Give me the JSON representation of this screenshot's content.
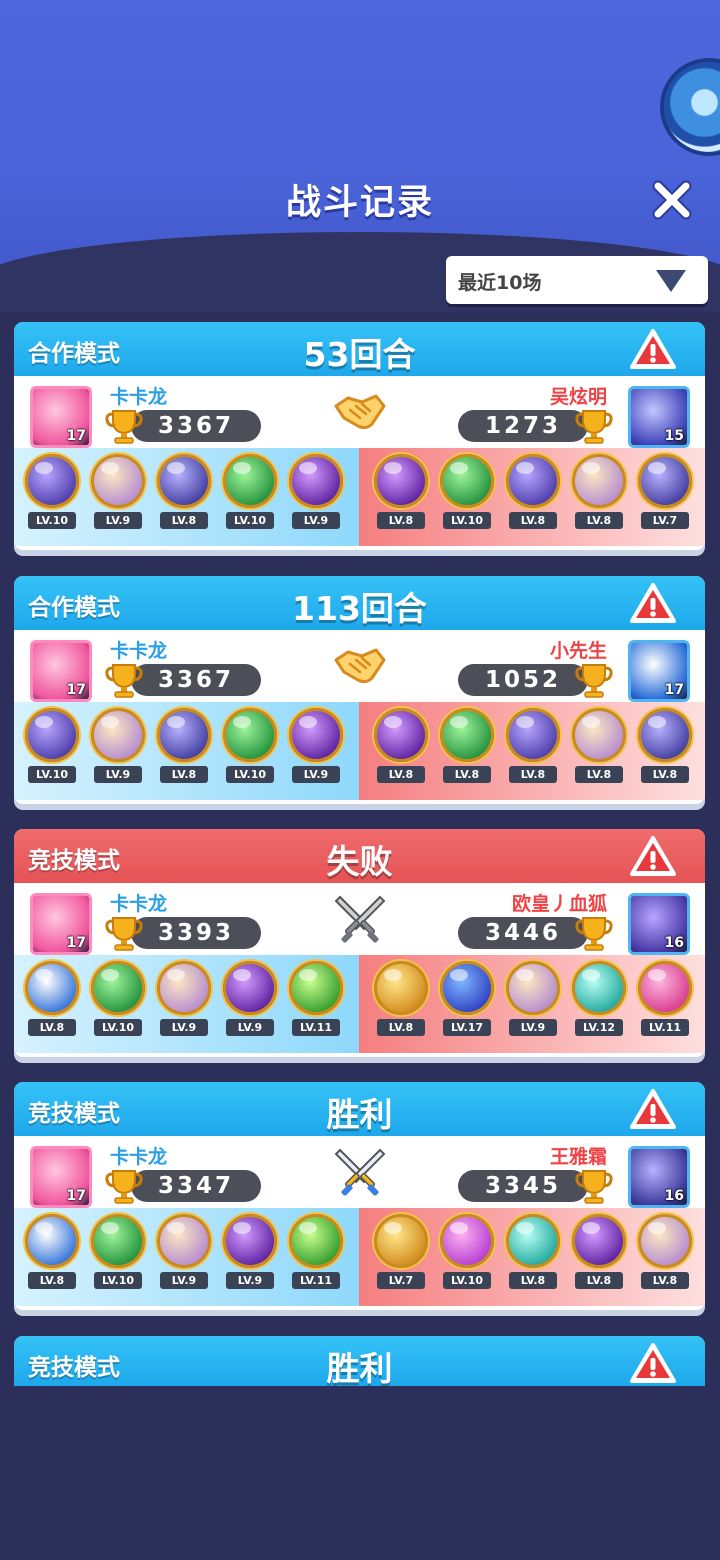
{
  "header": {
    "title": "战斗记录",
    "close_icon": "close-icon"
  },
  "filter": {
    "selected": "最近10场"
  },
  "orb_colors": {
    "ghost": [
      "#b7a6ff",
      "#4a3aa8"
    ],
    "squid": [
      "#fde7c2",
      "#b38ad0"
    ],
    "rock": [
      "#b9b2ff",
      "#3d3a9b"
    ],
    "arrow": [
      "#9ff59a",
      "#1f8e3a"
    ],
    "butterfly": [
      "#d49bff",
      "#5a1e9c"
    ],
    "koi": [
      "#ffffff",
      "#2d6fd8"
    ],
    "gem": [
      "#c9ff8e",
      "#2f9a2a"
    ],
    "knight": [
      "#ffe68a",
      "#d2891b"
    ],
    "swirl": [
      "#7fb6ff",
      "#2b3ec0"
    ],
    "tornado": [
      "#b7fff4",
      "#1ea69a"
    ],
    "feather": [
      "#ffb6df",
      "#d6388b"
    ],
    "jelly": [
      "#ffb1f2",
      "#b23ad0"
    ],
    "heart": [
      "#ffc7df",
      "#f0559d"
    ],
    "sphere": [
      "#c4c6ff",
      "#3f43b8"
    ]
  },
  "records": [
    {
      "mode": "合作模式",
      "result": "53回合",
      "style": "blue",
      "vs": "handshake",
      "me": {
        "name": "卡卡龙",
        "score": "3367",
        "avatar": "heart",
        "level": "17"
      },
      "op": {
        "name": "吴炫明",
        "score": "1273",
        "avatar": "sphere",
        "level": "15"
      },
      "me_units": [
        [
          "ghost",
          "LV.10"
        ],
        [
          "squid",
          "LV.9"
        ],
        [
          "rock",
          "LV.8"
        ],
        [
          "arrow",
          "LV.10"
        ],
        [
          "butterfly",
          "LV.9"
        ]
      ],
      "op_units": [
        [
          "butterfly",
          "LV.8"
        ],
        [
          "arrow",
          "LV.10"
        ],
        [
          "ghost",
          "LV.8"
        ],
        [
          "squid",
          "LV.8"
        ],
        [
          "rock",
          "LV.7"
        ]
      ]
    },
    {
      "mode": "合作模式",
      "result": "113回合",
      "style": "blue",
      "vs": "handshake",
      "me": {
        "name": "卡卡龙",
        "score": "3367",
        "avatar": "heart",
        "level": "17"
      },
      "op": {
        "name": "小先生",
        "score": "1052",
        "avatar": "koi",
        "level": "17"
      },
      "me_units": [
        [
          "ghost",
          "LV.10"
        ],
        [
          "squid",
          "LV.9"
        ],
        [
          "rock",
          "LV.8"
        ],
        [
          "arrow",
          "LV.10"
        ],
        [
          "butterfly",
          "LV.9"
        ]
      ],
      "op_units": [
        [
          "butterfly",
          "LV.8"
        ],
        [
          "arrow",
          "LV.8"
        ],
        [
          "ghost",
          "LV.8"
        ],
        [
          "squid",
          "LV.8"
        ],
        [
          "rock",
          "LV.8"
        ]
      ]
    },
    {
      "mode": "竞技模式",
      "result": "失败",
      "style": "red",
      "vs": "swords-grey",
      "me": {
        "name": "卡卡龙",
        "score": "3393",
        "avatar": "heart",
        "level": "17"
      },
      "op": {
        "name": "欧皇丿血狐",
        "score": "3446",
        "avatar": "ghost",
        "level": "16"
      },
      "me_units": [
        [
          "koi",
          "LV.8"
        ],
        [
          "arrow",
          "LV.10"
        ],
        [
          "squid",
          "LV.9"
        ],
        [
          "butterfly",
          "LV.9"
        ],
        [
          "gem",
          "LV.11"
        ]
      ],
      "op_units": [
        [
          "knight",
          "LV.8"
        ],
        [
          "swirl",
          "LV.17"
        ],
        [
          "squid",
          "LV.9"
        ],
        [
          "tornado",
          "LV.12"
        ],
        [
          "feather",
          "LV.11"
        ]
      ]
    },
    {
      "mode": "竞技模式",
      "result": "胜利",
      "style": "blue",
      "vs": "swords-color",
      "me": {
        "name": "卡卡龙",
        "score": "3347",
        "avatar": "heart",
        "level": "17"
      },
      "op": {
        "name": "王雅霜",
        "score": "3345",
        "avatar": "rock",
        "level": "16"
      },
      "me_units": [
        [
          "koi",
          "LV.8"
        ],
        [
          "arrow",
          "LV.10"
        ],
        [
          "squid",
          "LV.9"
        ],
        [
          "butterfly",
          "LV.9"
        ],
        [
          "gem",
          "LV.11"
        ]
      ],
      "op_units": [
        [
          "knight",
          "LV.7"
        ],
        [
          "jelly",
          "LV.10"
        ],
        [
          "tornado",
          "LV.8"
        ],
        [
          "butterfly",
          "LV.8"
        ],
        [
          "squid",
          "LV.8"
        ]
      ]
    }
  ],
  "partial": {
    "mode": "竞技模式",
    "result": "胜利",
    "style": "blue"
  }
}
